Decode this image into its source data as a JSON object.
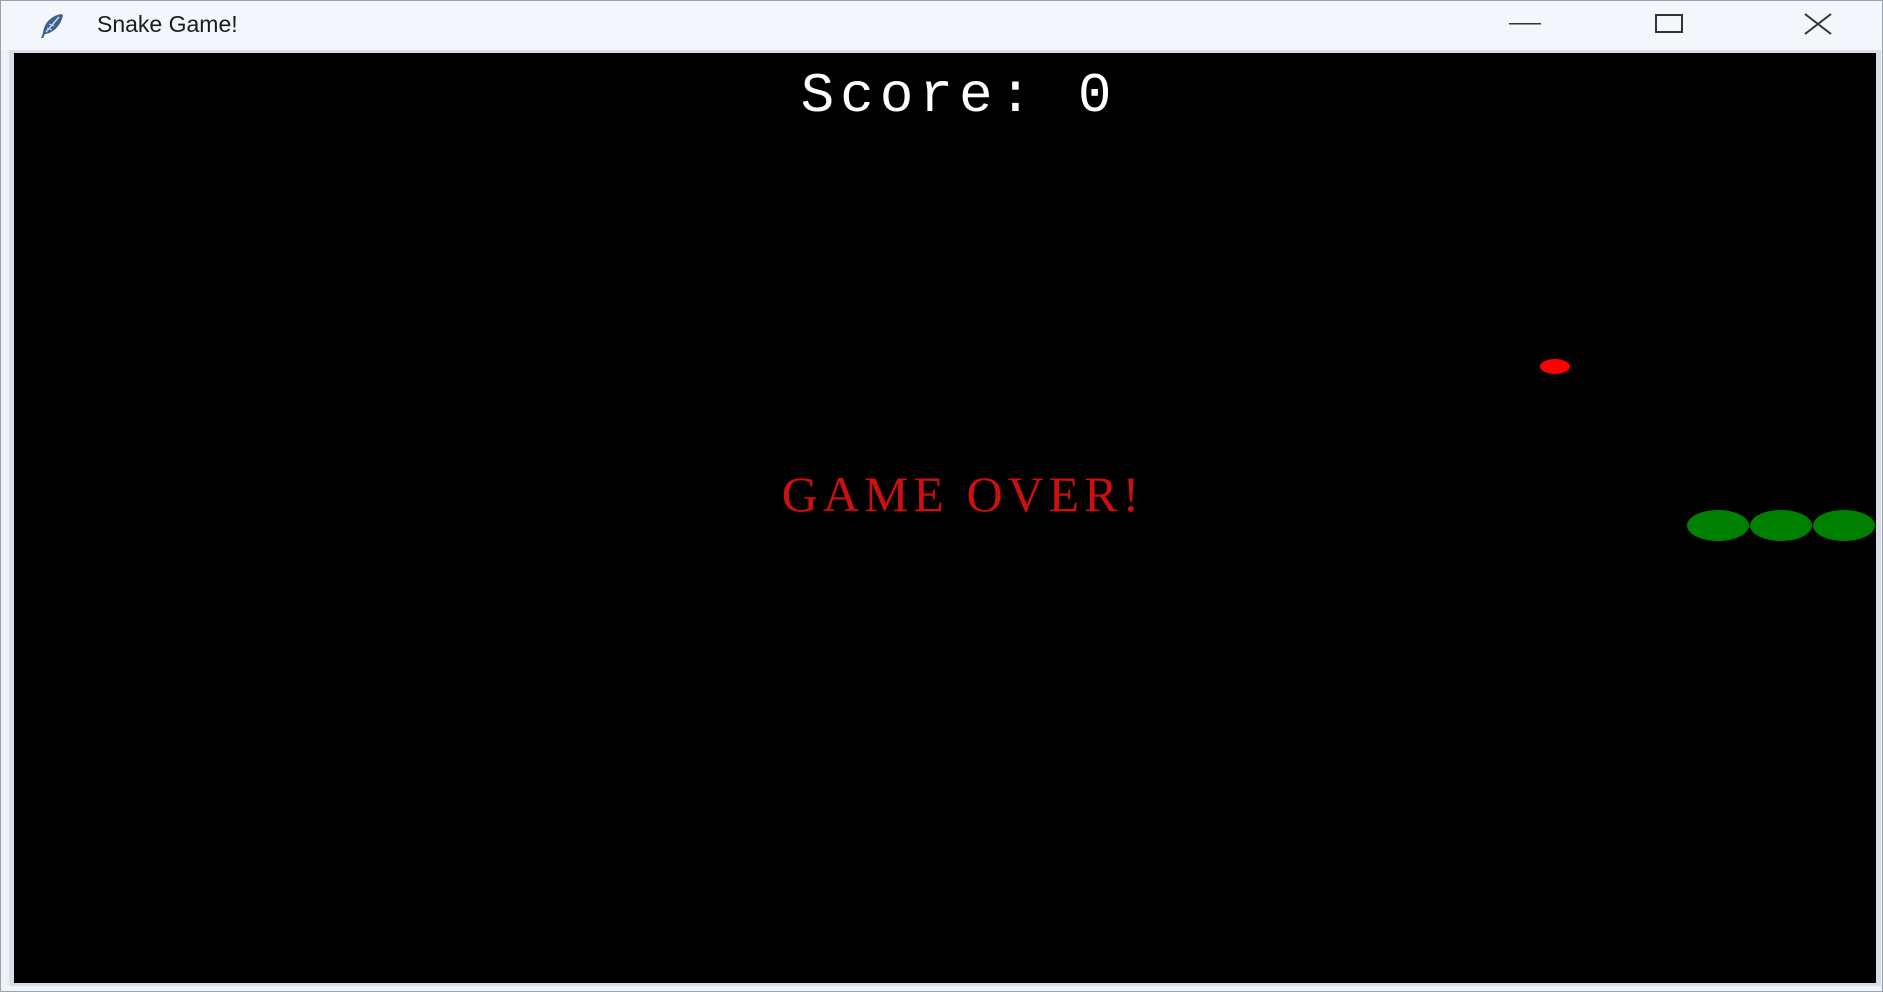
{
  "window": {
    "title": "Snake Game!",
    "icon": "feather-icon",
    "controls": [
      "minimize-icon",
      "maximize-icon",
      "close-icon"
    ]
  },
  "game": {
    "score_text": "Score: 0",
    "score_label": "Score:",
    "score": 0,
    "status_text": "GAME OVER!",
    "colors": {
      "background": "#000000",
      "score": "#ffffff",
      "game_over": "#cc1010",
      "food": "#ff0000",
      "snake": "#008000"
    },
    "snake_length": 3
  }
}
